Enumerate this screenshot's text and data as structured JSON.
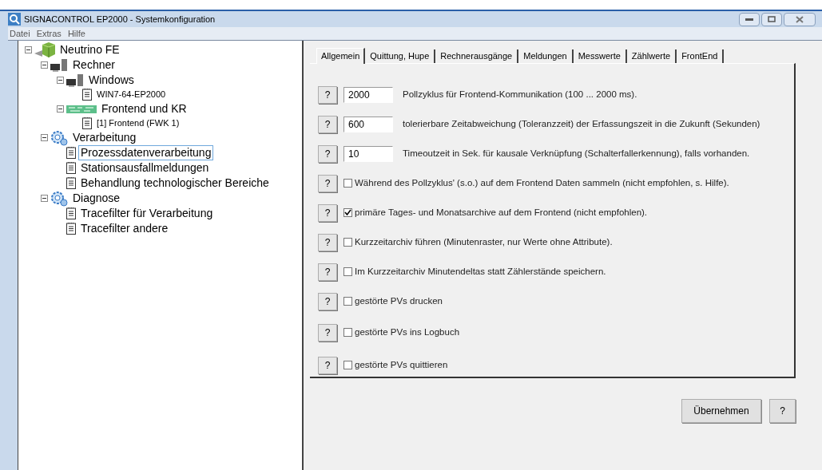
{
  "window": {
    "title": "SIGNACONTROL EP2000 - Systemkonfiguration"
  },
  "menu": [
    "Datei",
    "Extras",
    "Hilfe"
  ],
  "tree": [
    {
      "label": "Neutrino FE",
      "kind": "cube",
      "expanded": true,
      "selected": false,
      "children": [
        {
          "label": "Rechner",
          "kind": "computer",
          "expanded": true,
          "selected": false,
          "children": [
            {
              "label": "Windows",
              "kind": "computer",
              "expanded": true,
              "selected": false,
              "children": [
                {
                  "label": "WIN7-64-EP2000",
                  "kind": "doc",
                  "selected": false
                }
              ]
            },
            {
              "label": "Frontend und KR",
              "kind": "board",
              "expanded": true,
              "selected": false,
              "children": [
                {
                  "label": "[1] Frontend (FWK 1)",
                  "kind": "doc",
                  "selected": false
                }
              ]
            }
          ]
        },
        {
          "label": "Verarbeitung",
          "kind": "gear",
          "expanded": true,
          "selected": false,
          "children": [
            {
              "label": "Prozessdatenverarbeitung",
              "kind": "doc",
              "selected": true
            },
            {
              "label": "Stationsausfallmeldungen",
              "kind": "doc",
              "selected": false
            },
            {
              "label": "Behandlung technologischer Bereiche",
              "kind": "doc",
              "selected": false
            }
          ]
        },
        {
          "label": "Diagnose",
          "kind": "gear",
          "expanded": true,
          "selected": false,
          "children": [
            {
              "label": "Tracefilter für Verarbeitung",
              "kind": "doc",
              "selected": false
            },
            {
              "label": "Tracefilter andere",
              "kind": "doc",
              "selected": false
            }
          ]
        }
      ]
    }
  ],
  "tabs": [
    {
      "label": "Allgemein",
      "selected": true
    },
    {
      "label": "Quittung, Hupe",
      "selected": false
    },
    {
      "label": "Rechnerausgänge",
      "selected": false
    },
    {
      "label": "Meldungen",
      "selected": false
    },
    {
      "label": "Messwerte",
      "selected": false
    },
    {
      "label": "Zählwerte",
      "selected": false
    },
    {
      "label": "FrontEnd",
      "selected": false
    }
  ],
  "settings": [
    {
      "kind": "field",
      "help": "?",
      "value": "2000",
      "label": "Pollzyklus für Frontend-Kommunikation (100 ... 2000 ms)."
    },
    {
      "kind": "field",
      "help": "?",
      "value": "600",
      "label": "tolerierbare Zeitabweichung (Toleranzzeit) der Erfassungszeit in die Zukunft (Sekunden)"
    },
    {
      "kind": "field",
      "help": "?",
      "value": "10",
      "label": "Timeoutzeit in Sek. für kausale Verknüpfung (Schalterfallerkennung), falls vorhanden."
    },
    {
      "kind": "checkbox",
      "help": "?",
      "checked": false,
      "label": "Während des Pollzyklus' (s.o.) auf dem Frontend Daten sammeln (nicht empfohlen, s. Hilfe)."
    },
    {
      "kind": "checkbox",
      "help": "?",
      "checked": true,
      "label": "primäre Tages- und Monatsarchive auf dem Frontend (nicht empfohlen)."
    },
    {
      "kind": "checkbox",
      "help": "?",
      "checked": false,
      "label": "Kurzzeitarchiv führen (Minutenraster, nur Werte ohne Attribute)."
    },
    {
      "kind": "checkbox",
      "help": "?",
      "checked": false,
      "label": "Im Kurzzeitarchiv Minutendeltas statt Zählerstände speichern."
    },
    {
      "kind": "checkbox",
      "help": "?",
      "checked": false,
      "label": "gestörte PVs drucken"
    },
    {
      "kind": "checkbox",
      "help": "?",
      "checked": false,
      "label": "gestörte PVs ins Logbuch"
    },
    {
      "kind": "checkbox",
      "help": "?",
      "checked": false,
      "label": "gestörte PVs quittieren"
    }
  ],
  "buttons": {
    "apply": "Übernehmen",
    "help": "?"
  }
}
